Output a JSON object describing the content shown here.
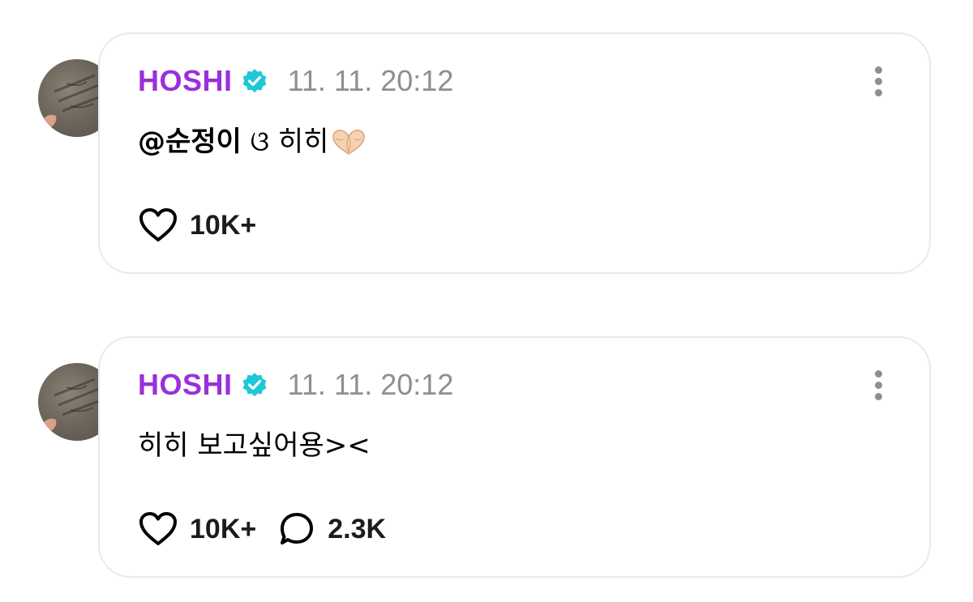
{
  "posts": [
    {
      "author": "HOSHI",
      "verified": true,
      "timestamp": "11. 11. 20:12",
      "mention": "@순정이",
      "text": "ଓ 히히",
      "emoji": "heart-hands",
      "likes": "10K+",
      "comments": null
    },
    {
      "author": "HOSHI",
      "verified": true,
      "timestamp": "11. 11. 20:12",
      "mention": "",
      "text": "히히 보고싶어용><",
      "likes": "10K+",
      "comments": "2.3K"
    }
  ],
  "colors": {
    "username": "#9b30d9",
    "verified_badge": "#1ec8d6",
    "timestamp": "#8e8e93",
    "card_border": "#e9e9ee"
  }
}
